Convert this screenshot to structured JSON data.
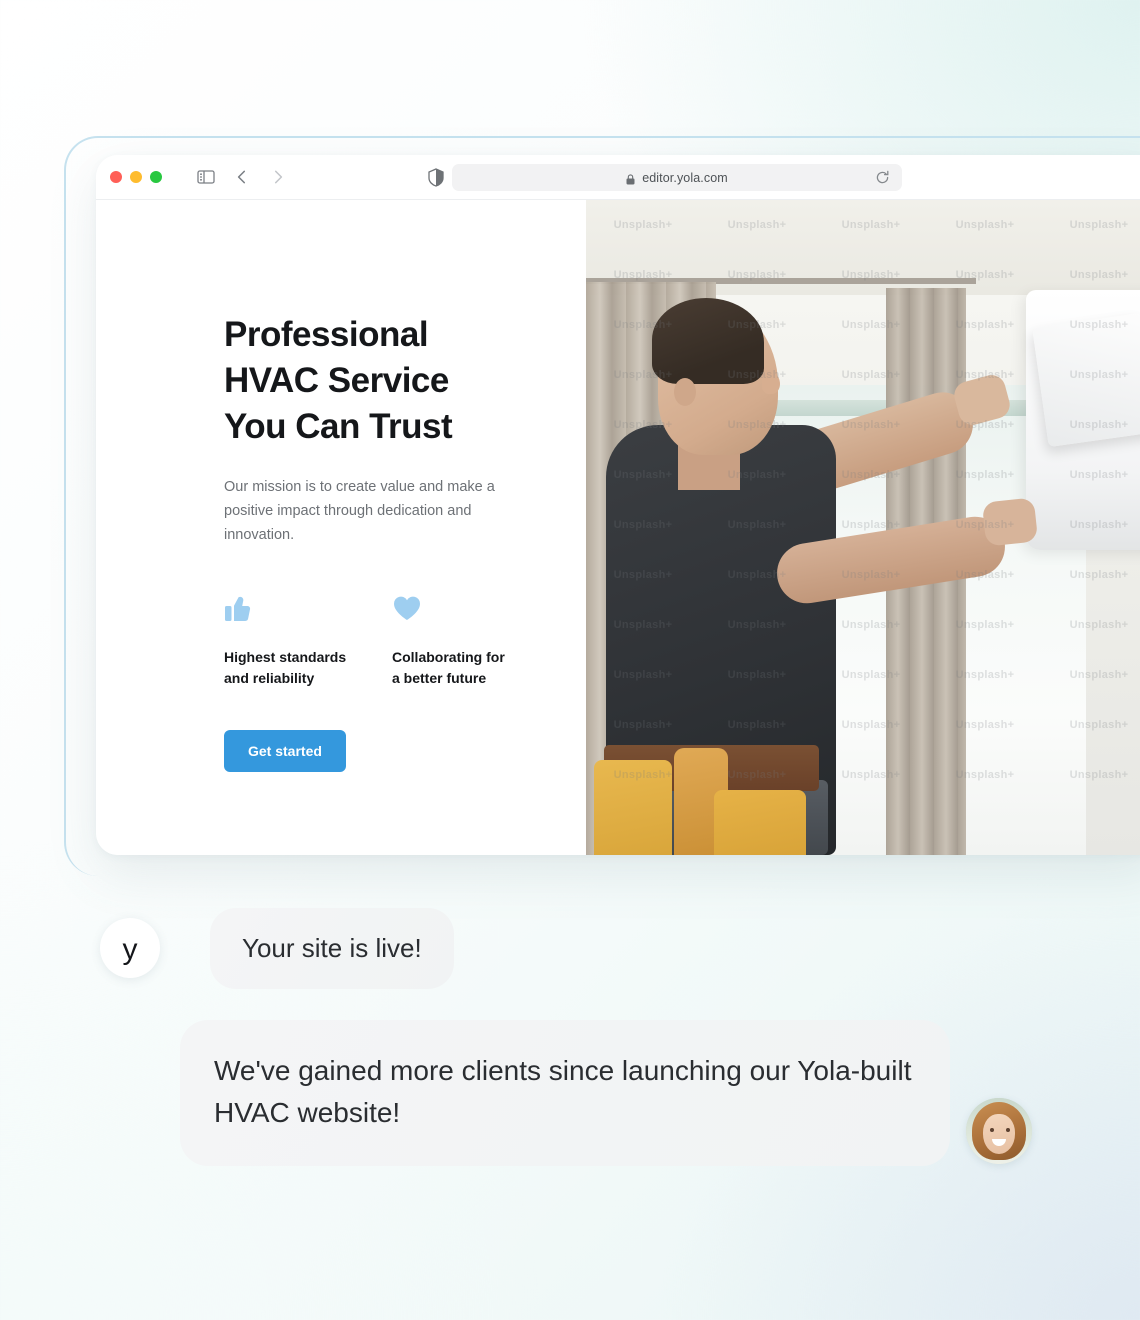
{
  "browser": {
    "window_controls": [
      "close",
      "minimize",
      "maximize"
    ],
    "toolbar": {
      "sidebar_icon": "sidebar-toggle-icon",
      "back_icon": "chevron-left-icon",
      "forward_icon": "chevron-right-icon",
      "shield_icon": "privacy-shield-icon",
      "lock_icon": "lock-icon",
      "url": "editor.yola.com",
      "reload_icon": "reload-icon"
    }
  },
  "hero": {
    "title": "Professional\nHVAC Service\nYou Can Trust",
    "subtitle": "Our mission is to create value and make a positive impact through dedication and innovation.",
    "features": [
      {
        "icon": "thumbs-up-icon",
        "label": "Highest standards\nand reliability"
      },
      {
        "icon": "heart-icon",
        "label": "Collaborating for\na better future"
      }
    ],
    "cta_label": "Get started",
    "photo": {
      "alt": "HVAC technician installing a wall mounted air conditioner",
      "watermark": "Unsplash+"
    }
  },
  "chat": {
    "messages": [
      {
        "avatar": "yola-logo",
        "avatar_letter": "y",
        "text": "Your site is live!"
      },
      {
        "avatar": "client-photo",
        "text": "We've gained more clients since launching our Yola-built HVAC website!"
      }
    ]
  },
  "colors": {
    "accent_blue": "#3498dd",
    "feature_icon_blue": "#9ecef0",
    "frame_border": "#c6e2ef",
    "bubble_bg": "#f2f3f4",
    "text_primary": "#15171a",
    "text_muted": "#6d7176"
  }
}
